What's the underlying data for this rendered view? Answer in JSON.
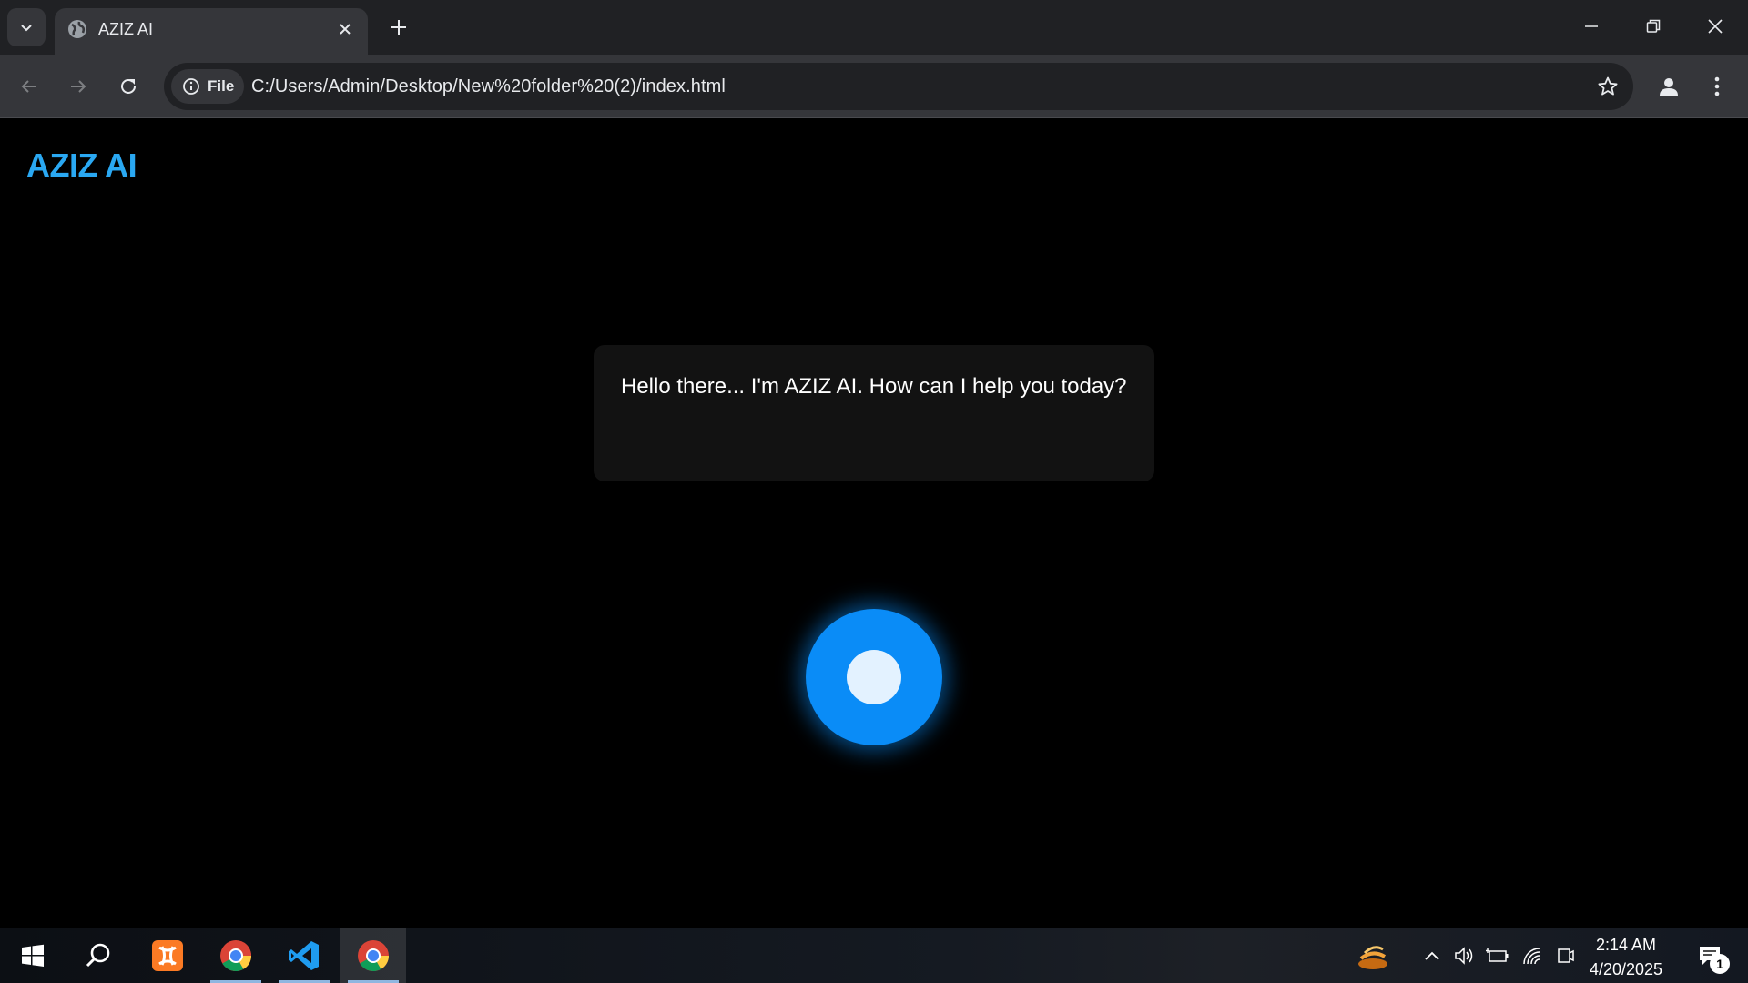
{
  "browser": {
    "tab_title": "AZIZ AI",
    "site_chip_label": "File",
    "url": "C:/Users/Admin/Desktop/New%20folder%20(2)/index.html"
  },
  "page": {
    "brand": "AZIZ AI",
    "message": "Hello there... I'm AZIZ AI. How can I help you today?",
    "orb_color": "#0a8cf7"
  },
  "taskbar": {
    "apps": [
      "start-icon",
      "search-icon",
      "xampp-icon",
      "chrome-icon",
      "vscode-icon",
      "chrome-icon"
    ],
    "time": "2:14 AM",
    "date": "4/20/2025",
    "notification_count": "1"
  }
}
